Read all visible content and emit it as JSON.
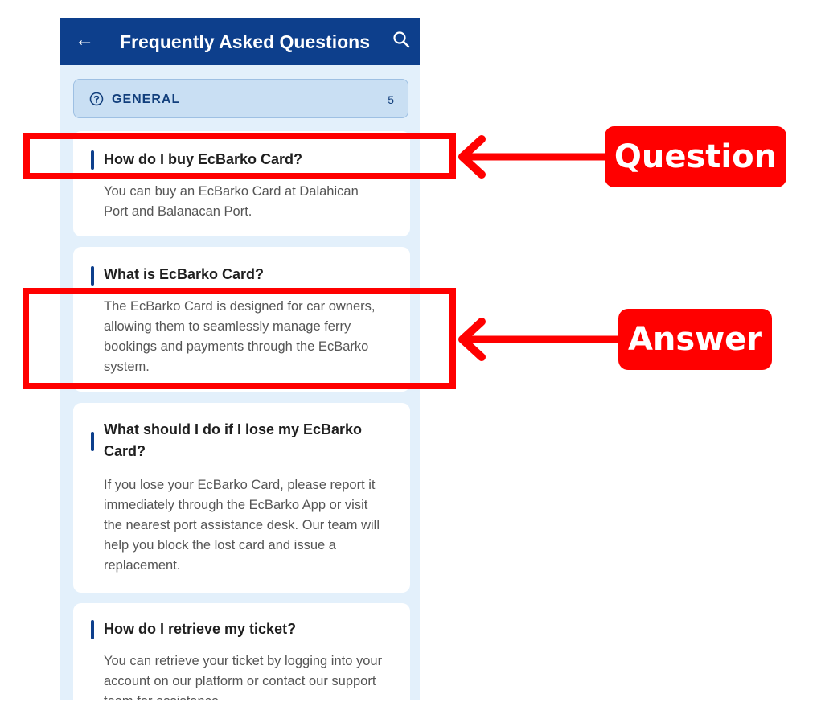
{
  "appbar": {
    "title": "Frequently Asked Questions",
    "back_icon": "arrow-left-icon",
    "search_icon": "search-icon"
  },
  "section": {
    "icon": "help-circle-icon",
    "label": "GENERAL",
    "count": "5"
  },
  "faqs": [
    {
      "question": "How do I buy EcBarko Card?",
      "answer": "You can buy an EcBarko Card at Dalahican Port and Balanacan Port."
    },
    {
      "question": "What is EcBarko Card?",
      "answer": "The EcBarko Card is designed for car owners, allowing them to seamlessly manage ferry bookings and payments through the EcBarko system."
    },
    {
      "question": "What should I do if I lose my EcBarko Card?",
      "answer": "If you lose your EcBarko Card, please report it immediately through the EcBarko App or visit the nearest port assistance desk. Our team will help you block the lost card and issue a replacement."
    },
    {
      "question": "How do I retrieve my ticket?",
      "answer": "You can retrieve your ticket by logging into your account on our platform or contact our support team for assistance."
    }
  ],
  "annotations": {
    "question_label": "Question",
    "answer_label": "Answer",
    "color": "#ff0000"
  },
  "colors": {
    "appbar": "#0d3f8c",
    "background": "#e3f0fb",
    "section": "#c9dff3"
  }
}
